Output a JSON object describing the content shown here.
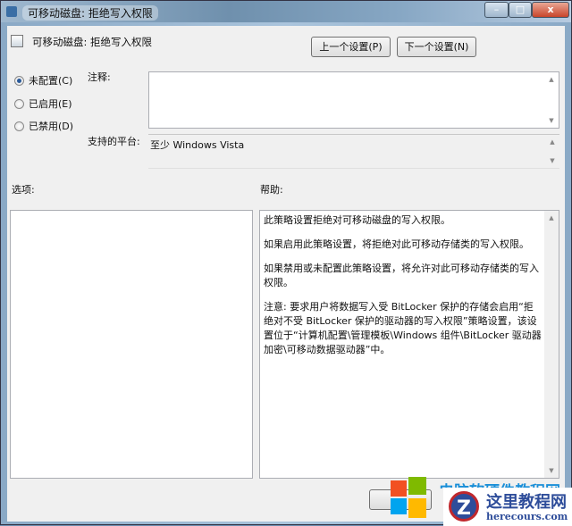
{
  "window": {
    "title": "可移动磁盘: 拒绝写入权限",
    "minimize": "–",
    "maximize": "□",
    "close": "x"
  },
  "header": {
    "title": "可移动磁盘: 拒绝写入权限",
    "prev_button": "上一个设置(P)",
    "next_button": "下一个设置(N)"
  },
  "state": {
    "options": [
      {
        "label": "未配置(C)",
        "selected": true
      },
      {
        "label": "已启用(E)",
        "selected": false
      },
      {
        "label": "已禁用(D)",
        "selected": false
      }
    ]
  },
  "comment": {
    "label": "注释:",
    "value": ""
  },
  "platform": {
    "label": "支持的平台:",
    "value": "至少 Windows Vista"
  },
  "options_label": "选项:",
  "help": {
    "label": "帮助:",
    "paragraphs": [
      "此策略设置拒绝对可移动磁盘的写入权限。",
      "如果启用此策略设置，将拒绝对此可移动存储类的写入权限。",
      "如果禁用或未配置此策略设置，将允许对此可移动存储类的写入权限。",
      "注意: 要求用户将数据写入受 BitLocker 保护的存储会启用“拒绝对不受 BitLocker 保护的驱动器的写入权限”策略设置，该设置位于“计算机配置\\管理模板\\Windows 组件\\BitLocker 驱动器加密\\可移动数据驱动器”中。"
    ]
  },
  "watermark": {
    "top_text": "电脑软硬件教程网",
    "brand": "这里教程网",
    "url": "herecours.com"
  }
}
